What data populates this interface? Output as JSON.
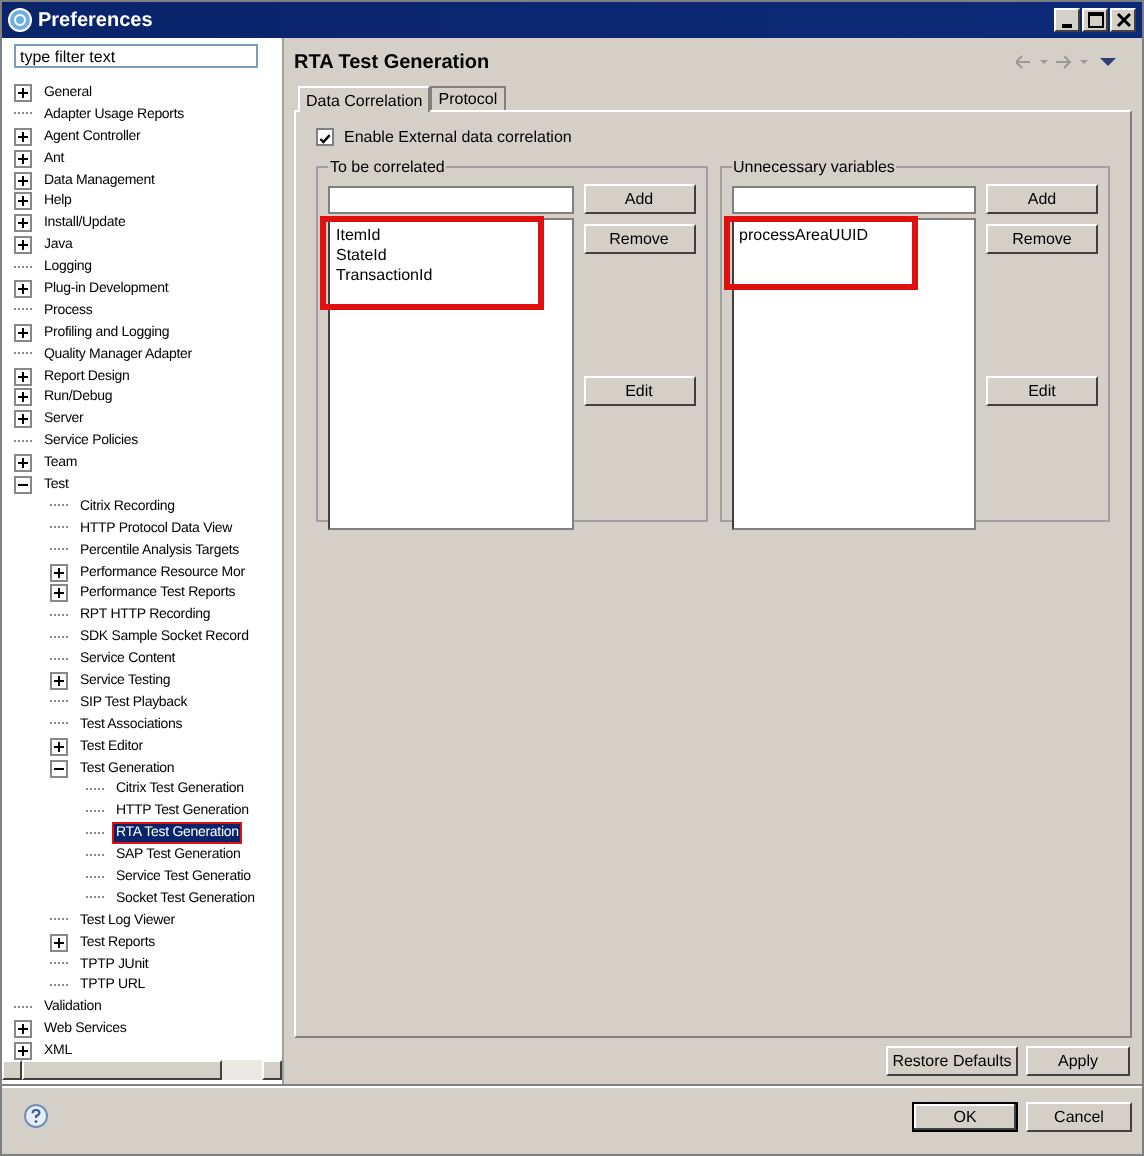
{
  "window": {
    "title": "Preferences"
  },
  "filter": {
    "placeholder": "type filter text"
  },
  "tree": [
    {
      "label": "General",
      "expanded": false,
      "selected": false
    },
    {
      "label": "Adapter Usage Reports",
      "selected": false
    },
    {
      "label": "Agent Controller",
      "expanded": false,
      "selected": false
    },
    {
      "label": "Ant",
      "expanded": false,
      "selected": false
    },
    {
      "label": "Data Management",
      "expanded": false,
      "selected": false
    },
    {
      "label": "Help",
      "expanded": false,
      "selected": false
    },
    {
      "label": "Install/Update",
      "expanded": false,
      "selected": false
    },
    {
      "label": "Java",
      "expanded": false,
      "selected": false
    },
    {
      "label": "Logging",
      "selected": false
    },
    {
      "label": "Plug-in Development",
      "expanded": false,
      "selected": false
    },
    {
      "label": "Process",
      "selected": false
    },
    {
      "label": "Profiling and Logging",
      "expanded": false,
      "selected": false
    },
    {
      "label": "Quality Manager Adapter",
      "selected": false
    },
    {
      "label": "Report Design",
      "expanded": false,
      "selected": false
    },
    {
      "label": "Run/Debug",
      "expanded": false,
      "selected": false
    },
    {
      "label": "Server",
      "expanded": false,
      "selected": false
    },
    {
      "label": "Service Policies",
      "selected": false
    },
    {
      "label": "Team",
      "expanded": false,
      "selected": false
    },
    {
      "label": "Test",
      "expanded": true,
      "selected": false,
      "children": [
        {
          "label": "Citrix Recording",
          "selected": false
        },
        {
          "label": "HTTP Protocol Data View",
          "selected": false
        },
        {
          "label": "Percentile Analysis Targets",
          "selected": false
        },
        {
          "label": "Performance Resource Mor",
          "expanded": false,
          "selected": false
        },
        {
          "label": "Performance Test Reports",
          "expanded": false,
          "selected": false
        },
        {
          "label": "RPT HTTP Recording",
          "selected": false
        },
        {
          "label": "SDK Sample Socket Record",
          "selected": false
        },
        {
          "label": "Service Content",
          "selected": false
        },
        {
          "label": "Service Testing",
          "expanded": false,
          "selected": false
        },
        {
          "label": "SIP Test Playback",
          "selected": false
        },
        {
          "label": "Test Associations",
          "selected": false
        },
        {
          "label": "Test Editor",
          "expanded": false,
          "selected": false
        },
        {
          "label": "Test Generation",
          "expanded": true,
          "selected": false,
          "children": [
            {
              "label": "Citrix Test Generation",
              "selected": false
            },
            {
              "label": "HTTP Test Generation",
              "selected": false
            },
            {
              "label": "RTA Test Generation",
              "selected": true
            },
            {
              "label": "SAP Test Generation",
              "selected": false
            },
            {
              "label": "Service Test Generatio",
              "selected": false
            },
            {
              "label": "Socket Test Generation",
              "selected": false
            }
          ]
        },
        {
          "label": "Test Log Viewer",
          "selected": false
        },
        {
          "label": "Test Reports",
          "expanded": false,
          "selected": false
        },
        {
          "label": "TPTP JUnit",
          "selected": false
        },
        {
          "label": "TPTP URL",
          "selected": false
        }
      ]
    },
    {
      "label": "Validation",
      "selected": false
    },
    {
      "label": "Web Services",
      "expanded": false,
      "selected": false
    },
    {
      "label": "XML",
      "expanded": false,
      "selected": false
    }
  ],
  "page": {
    "title": "RTA Test Generation"
  },
  "tabs": [
    {
      "label": "Data Correlation",
      "selected": true
    },
    {
      "label": "Protocol",
      "selected": false
    }
  ],
  "enable_external": {
    "label": "Enable External data correlation",
    "checked": true
  },
  "groups": [
    {
      "title": "To be correlated",
      "items": [
        "ItemId",
        "StateId",
        "TransactionId"
      ],
      "buttons": [
        "Add",
        "Remove",
        "Edit"
      ]
    },
    {
      "title": "Unnecessary variables",
      "items": [
        "processAreaUUID"
      ],
      "buttons": [
        "Add",
        "Remove",
        "Edit"
      ]
    }
  ],
  "page_buttons": [
    "Restore Defaults",
    "Apply"
  ],
  "dialog_buttons": [
    "OK",
    "Cancel"
  ]
}
